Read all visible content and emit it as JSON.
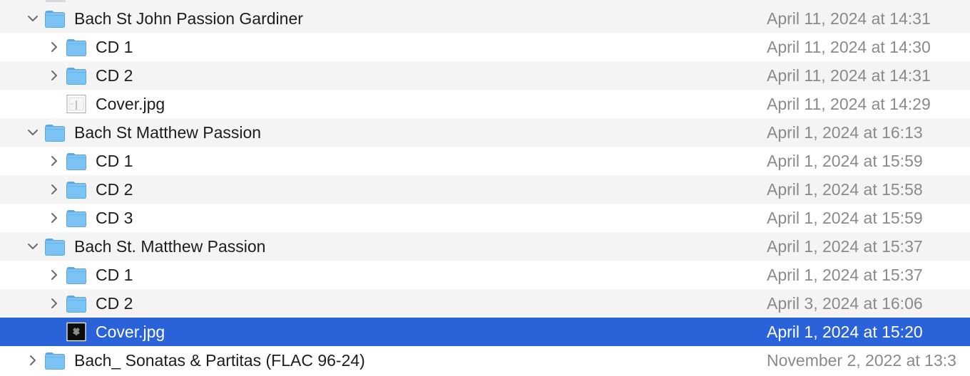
{
  "rows": [
    {
      "name": "Bach St John Passion Gardiner",
      "date": "April 11, 2024 at 14:31",
      "level": 0,
      "kind": "folder",
      "disclosure": "expanded",
      "selected": false
    },
    {
      "name": "CD 1",
      "date": "April 11, 2024 at 14:30",
      "level": 1,
      "kind": "folder",
      "disclosure": "collapsed",
      "selected": false
    },
    {
      "name": "CD 2",
      "date": "April 11, 2024 at 14:31",
      "level": 1,
      "kind": "folder",
      "disclosure": "collapsed",
      "selected": false
    },
    {
      "name": "Cover.jpg",
      "date": "April 11, 2024 at 14:29",
      "level": 1,
      "kind": "image-light",
      "disclosure": "none",
      "selected": false
    },
    {
      "name": "Bach St Matthew Passion",
      "date": "April 1, 2024 at 16:13",
      "level": 0,
      "kind": "folder",
      "disclosure": "expanded",
      "selected": false
    },
    {
      "name": "CD 1",
      "date": "April 1, 2024 at 15:59",
      "level": 1,
      "kind": "folder",
      "disclosure": "collapsed",
      "selected": false
    },
    {
      "name": "CD 2",
      "date": "April 1, 2024 at 15:58",
      "level": 1,
      "kind": "folder",
      "disclosure": "collapsed",
      "selected": false
    },
    {
      "name": "CD 3",
      "date": "April 1, 2024 at 15:59",
      "level": 1,
      "kind": "folder",
      "disclosure": "collapsed",
      "selected": false
    },
    {
      "name": "Bach St. Matthew Passion",
      "date": "April 1, 2024 at 15:37",
      "level": 0,
      "kind": "folder",
      "disclosure": "expanded",
      "selected": false
    },
    {
      "name": "CD 1",
      "date": "April 1, 2024 at 15:37",
      "level": 1,
      "kind": "folder",
      "disclosure": "collapsed",
      "selected": false
    },
    {
      "name": "CD 2",
      "date": "April 3, 2024 at 16:06",
      "level": 1,
      "kind": "folder",
      "disclosure": "collapsed",
      "selected": false
    },
    {
      "name": "Cover.jpg",
      "date": "April 1, 2024 at 15:20",
      "level": 1,
      "kind": "image-dark",
      "disclosure": "none",
      "selected": true
    },
    {
      "name": "Bach_ Sonatas & Partitas (FLAC 96-24)",
      "date": "November 2, 2022 at 13:3",
      "level": 0,
      "kind": "folder",
      "disclosure": "collapsed",
      "selected": false
    }
  ],
  "colors": {
    "selection": "#2a63d9",
    "alt_row": "#f4f4f5",
    "folder": "#7cc3f5",
    "date_text": "#8a8a8d"
  }
}
